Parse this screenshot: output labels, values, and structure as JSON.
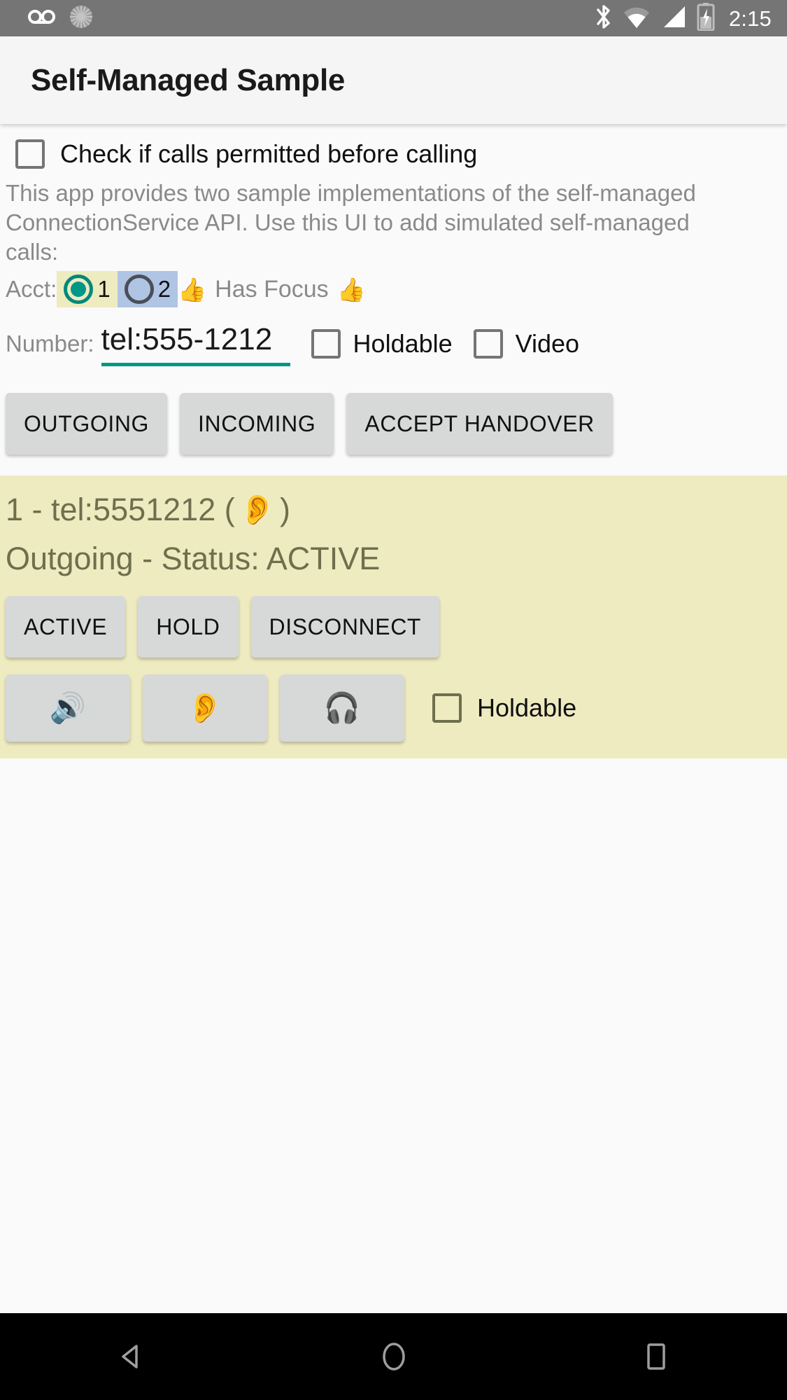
{
  "status_bar": {
    "icons_left": [
      "voicemail-icon",
      "sync-spinner-icon"
    ],
    "icons_right": [
      "bluetooth-icon",
      "wifi-icon",
      "cell-signal-icon",
      "battery-charging-icon"
    ],
    "clock": "2:15",
    "background": "#757575"
  },
  "app_bar": {
    "title": "Self-Managed Sample",
    "background": "#f5f5f5"
  },
  "permit_check": {
    "label": "Check if calls permitted before calling",
    "checked": false
  },
  "description": "This app provides two sample implementations of the self-managed ConnectionService API.  Use this UI to add simulated self-managed calls:",
  "account_row": {
    "label": "Acct:",
    "options": [
      {
        "value": "1",
        "selected": true,
        "chip_color": "#eeebc0",
        "radio_color": "#009688"
      },
      {
        "value": "2",
        "selected": false,
        "chip_color": "#b0c4e4",
        "radio_color": "#4a4f57"
      }
    ],
    "focus_emoji_left": "👍",
    "focus_text": "Has Focus",
    "focus_emoji_right": "👍"
  },
  "number_row": {
    "label": "Number:",
    "value": "tel:555-1212",
    "placeholder": "tel:555-1212",
    "underline_color": "#009688",
    "holdable": {
      "label": "Holdable",
      "checked": false
    },
    "video": {
      "label": "Video",
      "checked": false
    }
  },
  "actions": [
    {
      "label": "OUTGOING",
      "name": "outgoing-button"
    },
    {
      "label": "INCOMING",
      "name": "incoming-button"
    },
    {
      "label": "ACCEPT HANDOVER",
      "name": "accept-handover-button"
    }
  ],
  "call_card": {
    "background": "#eeebc0",
    "text_color": "#6f6f4e",
    "line1_prefix": "1 - tel:5551212 (",
    "line1_emoji": "👂",
    "line1_suffix": ")",
    "line2": "Outgoing - Status: ACTIVE",
    "state_buttons": [
      {
        "label": "ACTIVE",
        "name": "call-active-button"
      },
      {
        "label": "HOLD",
        "name": "call-hold-button"
      },
      {
        "label": "DISCONNECT",
        "name": "call-disconnect-button"
      }
    ],
    "audio_buttons": [
      {
        "emoji": "🔊",
        "name": "audio-speaker-button"
      },
      {
        "emoji": "👂",
        "name": "audio-earpiece-button"
      },
      {
        "emoji": "🎧",
        "name": "audio-headset-button"
      }
    ],
    "holdable": {
      "label": "Holdable",
      "checked": false
    }
  },
  "nav_bar": {
    "background": "#000000",
    "buttons": [
      "back-nav-button",
      "home-nav-button",
      "recents-nav-button"
    ]
  }
}
